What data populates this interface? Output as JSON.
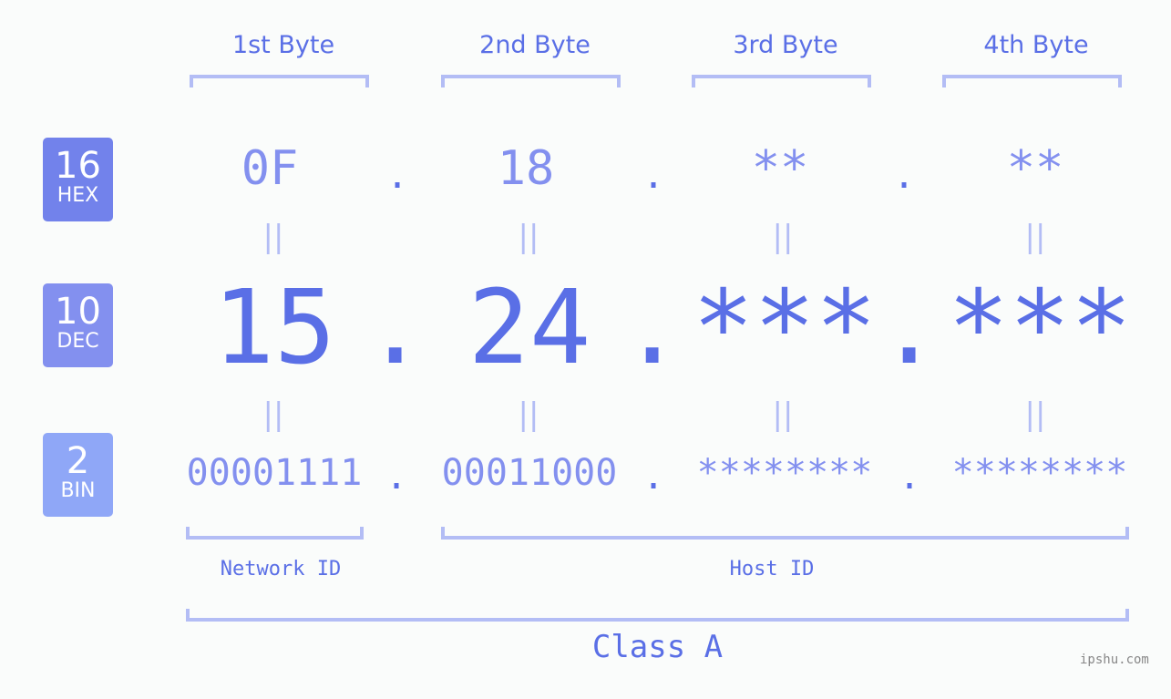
{
  "byte_headers": [
    "1st Byte",
    "2nd Byte",
    "3rd Byte",
    "4th Byte"
  ],
  "badges": {
    "hex": {
      "base": "16",
      "label": "HEX",
      "color": "#7282eb"
    },
    "dec": {
      "base": "10",
      "label": "DEC",
      "color": "#8390ef"
    },
    "bin": {
      "base": "2",
      "label": "BIN",
      "color": "#8fa7f7"
    }
  },
  "hex_values": [
    "0F",
    "18",
    "**",
    "**"
  ],
  "dec_values": [
    "15",
    "24",
    "***",
    "***"
  ],
  "bin_values": [
    "00001111",
    "00011000",
    "********",
    "********"
  ],
  "separator": ".",
  "equals_symbol": "||",
  "network_label": "Network ID",
  "host_label": "Host ID",
  "class_label": "Class A",
  "watermark": "ipshu.com",
  "colors": {
    "accent": "#5a6fe6",
    "light": "#8390ef",
    "bracket": "#b3bdf5"
  }
}
